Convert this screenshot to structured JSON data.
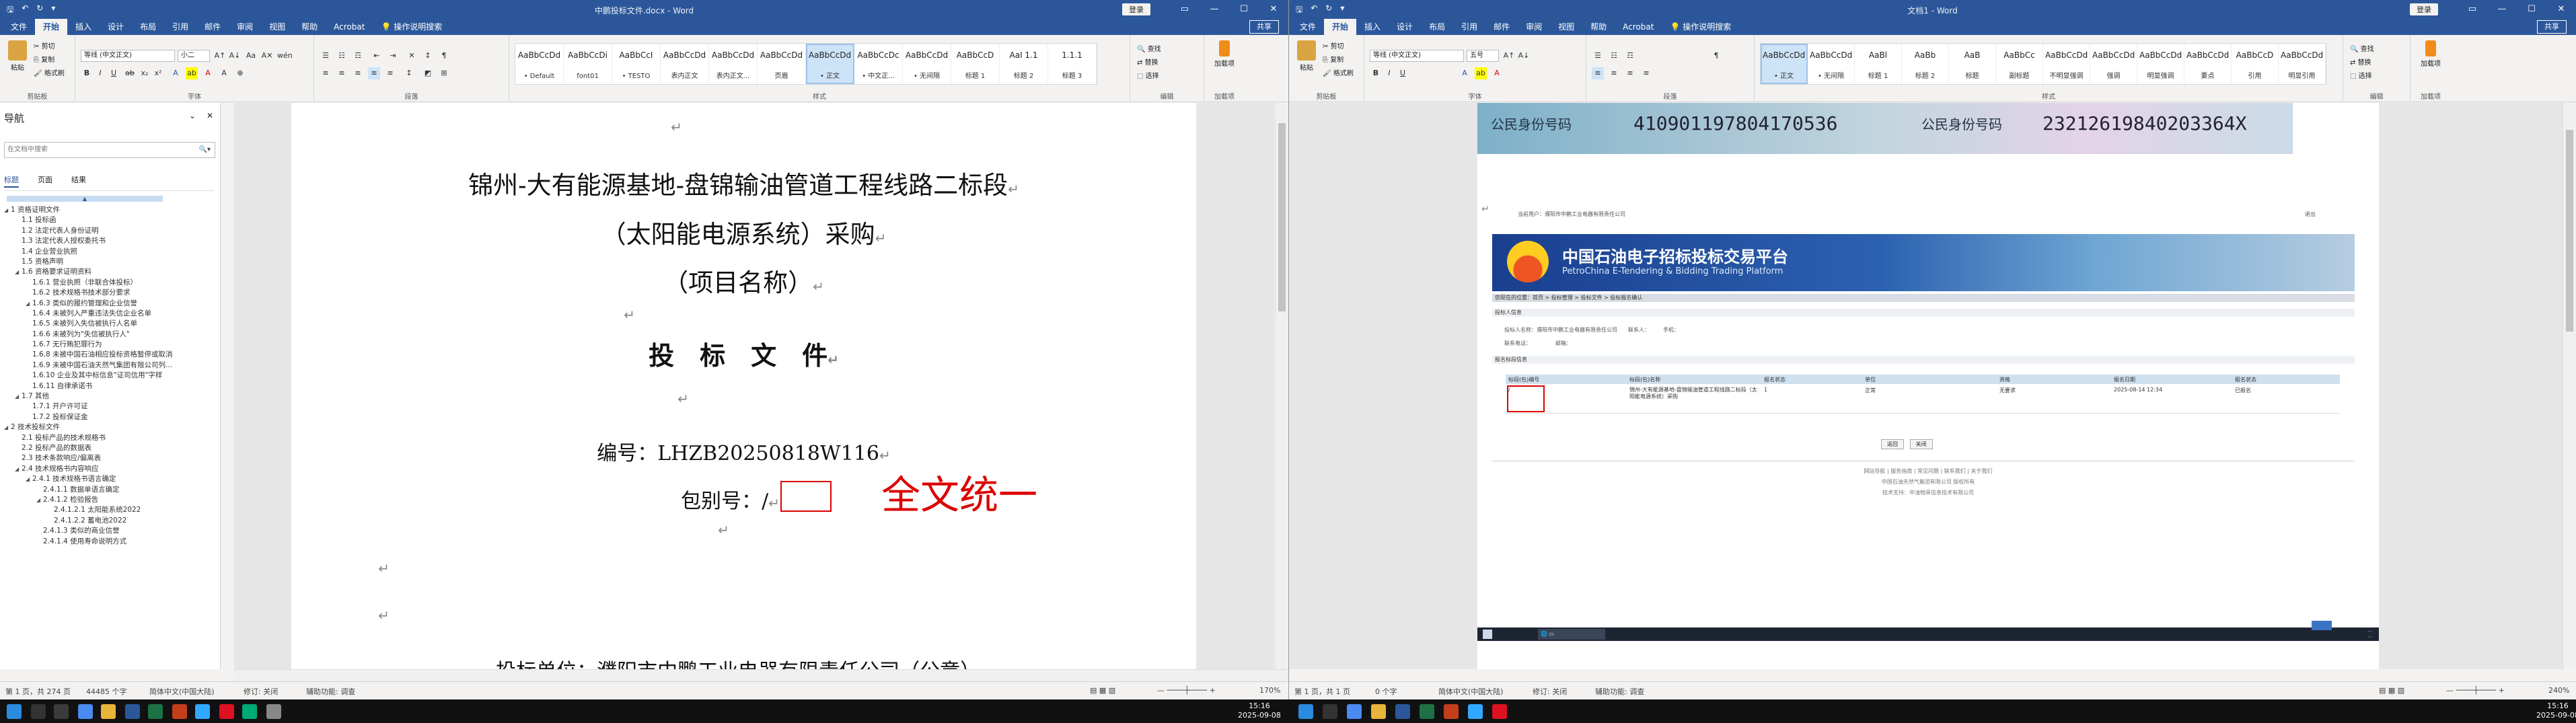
{
  "left": {
    "doc_title": "中鹏投标文件.docx - Word",
    "login": "登录",
    "share": "共享",
    "menu": [
      "文件",
      "开始",
      "插入",
      "设计",
      "布局",
      "引用",
      "邮件",
      "审阅",
      "视图",
      "帮助",
      "Acrobat"
    ],
    "tell_me": "操作说明搜索",
    "clipboard": {
      "paste": "粘贴",
      "cut": "剪切",
      "copy": "复制",
      "format_painter": "格式刷",
      "label": "剪贴板"
    },
    "font": {
      "name": "等线 (中文正文)",
      "size": "小二",
      "label": "字体"
    },
    "paragraph_label": "段落",
    "styles": [
      {
        "preview": "AaBbCcDd",
        "name": "• Default"
      },
      {
        "preview": "AaBbCcDi",
        "name": "font01"
      },
      {
        "preview": "AaBbCcI",
        "name": "• TESTO"
      },
      {
        "preview": "AaBbCcDd",
        "name": "表内正文"
      },
      {
        "preview": "AaBbCcDd",
        "name": "表内正文..."
      },
      {
        "preview": "AaBbCcDd",
        "name": "页眉"
      },
      {
        "preview": "AaBbCcDd",
        "name": "• 正文"
      },
      {
        "preview": "AaBbCcDc",
        "name": "• 中文正..."
      },
      {
        "preview": "AaBbCcDd",
        "name": "• 无间隔"
      },
      {
        "preview": "AaBbCcD",
        "name": "标题 1"
      },
      {
        "preview": "AaI 1.1",
        "name": "标题 2"
      },
      {
        "preview": "1.1.1",
        "name": "标题 3"
      }
    ],
    "styles_label": "样式",
    "editing": {
      "find": "查找",
      "replace": "替换",
      "select": "选择",
      "label": "编辑"
    },
    "addin": {
      "name": "加载项",
      "label": "加载项"
    },
    "nav": {
      "title": "导航",
      "search_placeholder": "在文档中搜索",
      "tabs": [
        "标题",
        "页面",
        "结果"
      ],
      "items": [
        {
          "level": 0,
          "text": "1 资格证明文件",
          "exp": "◢"
        },
        {
          "level": 1,
          "text": "1.1 投标函",
          "exp": ""
        },
        {
          "level": 1,
          "text": "1.2 法定代表人身份证明",
          "exp": ""
        },
        {
          "level": 1,
          "text": "1.3 法定代表人授权委托书",
          "exp": ""
        },
        {
          "level": 1,
          "text": "1.4 企业营业执照",
          "exp": ""
        },
        {
          "level": 1,
          "text": "1.5 资格声明",
          "exp": ""
        },
        {
          "level": 1,
          "text": "1.6 资格要求证明资料",
          "exp": "◢"
        },
        {
          "level": 2,
          "text": "1.6.1 营业执照（非联合体投标）",
          "exp": ""
        },
        {
          "level": 2,
          "text": "1.6.2 技术规格书技术部分要求",
          "exp": ""
        },
        {
          "level": 2,
          "text": "1.6.3 类似的履约管理和企业信誉",
          "exp": "◢"
        },
        {
          "level": 2,
          "text": "1.6.4 未被列入严重违法失信企业名单",
          "exp": ""
        },
        {
          "level": 2,
          "text": "1.6.5 未被列入失信被执行人名单",
          "exp": ""
        },
        {
          "level": 2,
          "text": "1.6.6 未被列为\"失信被执行人\"",
          "exp": ""
        },
        {
          "level": 2,
          "text": "1.6.7 无行贿犯罪行为",
          "exp": ""
        },
        {
          "level": 2,
          "text": "1.6.8 未被中国石油相应投标资格暂停或取消",
          "exp": ""
        },
        {
          "level": 2,
          "text": "1.6.9 未被中国石油天然气集团有限公司列...",
          "exp": ""
        },
        {
          "level": 2,
          "text": "1.6.10 企业及其中标信息\"证司信用\"字样",
          "exp": ""
        },
        {
          "level": 2,
          "text": "1.6.11 自律承诺书",
          "exp": ""
        },
        {
          "level": 1,
          "text": "1.7 其他",
          "exp": "◢"
        },
        {
          "level": 2,
          "text": "1.7.1 开户许可证",
          "exp": ""
        },
        {
          "level": 2,
          "text": "1.7.2 投标保证金",
          "exp": ""
        },
        {
          "level": 0,
          "text": "2 技术投标文件",
          "exp": "◢"
        },
        {
          "level": 1,
          "text": "2.1 投标产品的技术规格书",
          "exp": ""
        },
        {
          "level": 1,
          "text": "2.2 投标产品的数据表",
          "exp": ""
        },
        {
          "level": 1,
          "text": "2.3 技术条款响应/偏离表",
          "exp": ""
        },
        {
          "level": 1,
          "text": "2.4 技术规格书内容响应",
          "exp": "◢"
        },
        {
          "level": 2,
          "text": "2.4.1 技术规格书语言确定",
          "exp": "◢"
        },
        {
          "level": 3,
          "text": "2.4.1.1 数据单语言确定",
          "exp": ""
        },
        {
          "level": 3,
          "text": "2.4.1.2 检验报告",
          "exp": "◢"
        },
        {
          "level": 4,
          "text": "2.4.1.2.1 太阳能系统2022",
          "exp": ""
        },
        {
          "level": 4,
          "text": "2.4.1.2.2 蓄电池2022",
          "exp": ""
        },
        {
          "level": 3,
          "text": "2.4.1.3 类似的商业信誉",
          "exp": ""
        },
        {
          "level": 3,
          "text": "2.4.1.4 使用寿命说明方式",
          "exp": ""
        }
      ]
    },
    "document": {
      "title1": "锦州-大有能源基地-盘锦输油管道工程线路二标段",
      "title2": "（太阳能电源系统）采购",
      "title3": "（项目名称）",
      "heading": "投　标　文　件",
      "number_label": "编号：LHZB20250818W116",
      "package_label": "包别号：",
      "package_value": "/",
      "annotation": "全文统一",
      "bidder": "投标单位：濮阳市中鹏工业电器有限责任公司（公章）"
    },
    "status": {
      "page": "第 1 页，共 274 页",
      "words": "44485 个字",
      "lang": "简体中文(中国大陆)",
      "edit": "修订: 关闭",
      "focus": "辅助功能: 调查",
      "zoom": "170%"
    }
  },
  "right": {
    "doc_title": "文档1 - Word",
    "login": "登录",
    "share": "共享",
    "menu": [
      "文件",
      "开始",
      "插入",
      "设计",
      "布局",
      "引用",
      "邮件",
      "审阅",
      "视图",
      "帮助",
      "Acrobat"
    ],
    "tell_me": "操作说明搜索",
    "font": {
      "name": "等线 (中文正文)",
      "size": "五号"
    },
    "styles": [
      {
        "preview": "AaBbCcDd",
        "name": "• 正文"
      },
      {
        "preview": "AaBbCcDd",
        "name": "• 无间隔"
      },
      {
        "preview": "AaBl",
        "name": "标题 1"
      },
      {
        "preview": "AaBb",
        "name": "标题 2"
      },
      {
        "preview": "AaB",
        "name": "标题"
      },
      {
        "preview": "AaBbCc",
        "name": "副标题"
      },
      {
        "preview": "AaBbCcDd",
        "name": "不明显强调"
      },
      {
        "preview": "AaBbCcDd",
        "name": "强调"
      },
      {
        "preview": "AaBbCcDd",
        "name": "明显强调"
      },
      {
        "preview": "AaBbCcDd",
        "name": "要点"
      },
      {
        "preview": "AaBbCcD",
        "name": "引用"
      },
      {
        "preview": "AaBbCcDd",
        "name": "明显引用"
      }
    ],
    "id_label_1": "公民身份号码",
    "id_number_1": "410901197804170536",
    "id_label_2": "公民身份号码",
    "id_number_2": "23212619840203364X",
    "portal": {
      "topbar": "当前用户：濮阳市中鹏工业电器有限责任公司",
      "topright": "退出",
      "cn_name": "中国石油电子招标投标交易平台",
      "en_name": "PetroChina E-Tendering & Bidding Trading Platform",
      "crumb": "您现在的位置：首页 > 投标管理 > 投标文件 > 投标报名确认",
      "section1": "投标人信息",
      "section2": "报名标段信息",
      "info1": "投标人名称：濮阳市中鹏工业电器有限责任公司　　联系人：　　　手机：",
      "info2": "联系电话：　　　　　邮箱：",
      "headers": [
        "标段(包)编号",
        "标段(包)名称",
        "报名状态",
        "单位",
        "资格",
        "报名日期",
        "报名状态"
      ],
      "row": [
        "/",
        "锦州-大有能源基地-盘锦输油管道工程线路二标段（太阳能电源系统）采购",
        "1",
        "正常",
        "无要求",
        "2025-08-14 12:34",
        "已报名"
      ],
      "buttons": [
        "返回",
        "关闭"
      ],
      "footer1": "网站导航 | 服务指南 | 常见问题 | 联系我们 | 关于我们",
      "footer2": "中国石油天然气集团有限公司 版权所有",
      "footer3": "技术支持：中油物采信息技术有限公司"
    },
    "status": {
      "page": "第 1 页，共 1 页",
      "words": "0 个字",
      "lang": "简体中文(中国大陆)",
      "edit": "修订: 关闭",
      "focus": "辅助功能: 调查",
      "zoom": "240%"
    }
  },
  "taskbar": {
    "time_left": "15:16",
    "date_left": "2025-09-08",
    "time_right": "15:16",
    "date_right": "2025-09-08"
  }
}
